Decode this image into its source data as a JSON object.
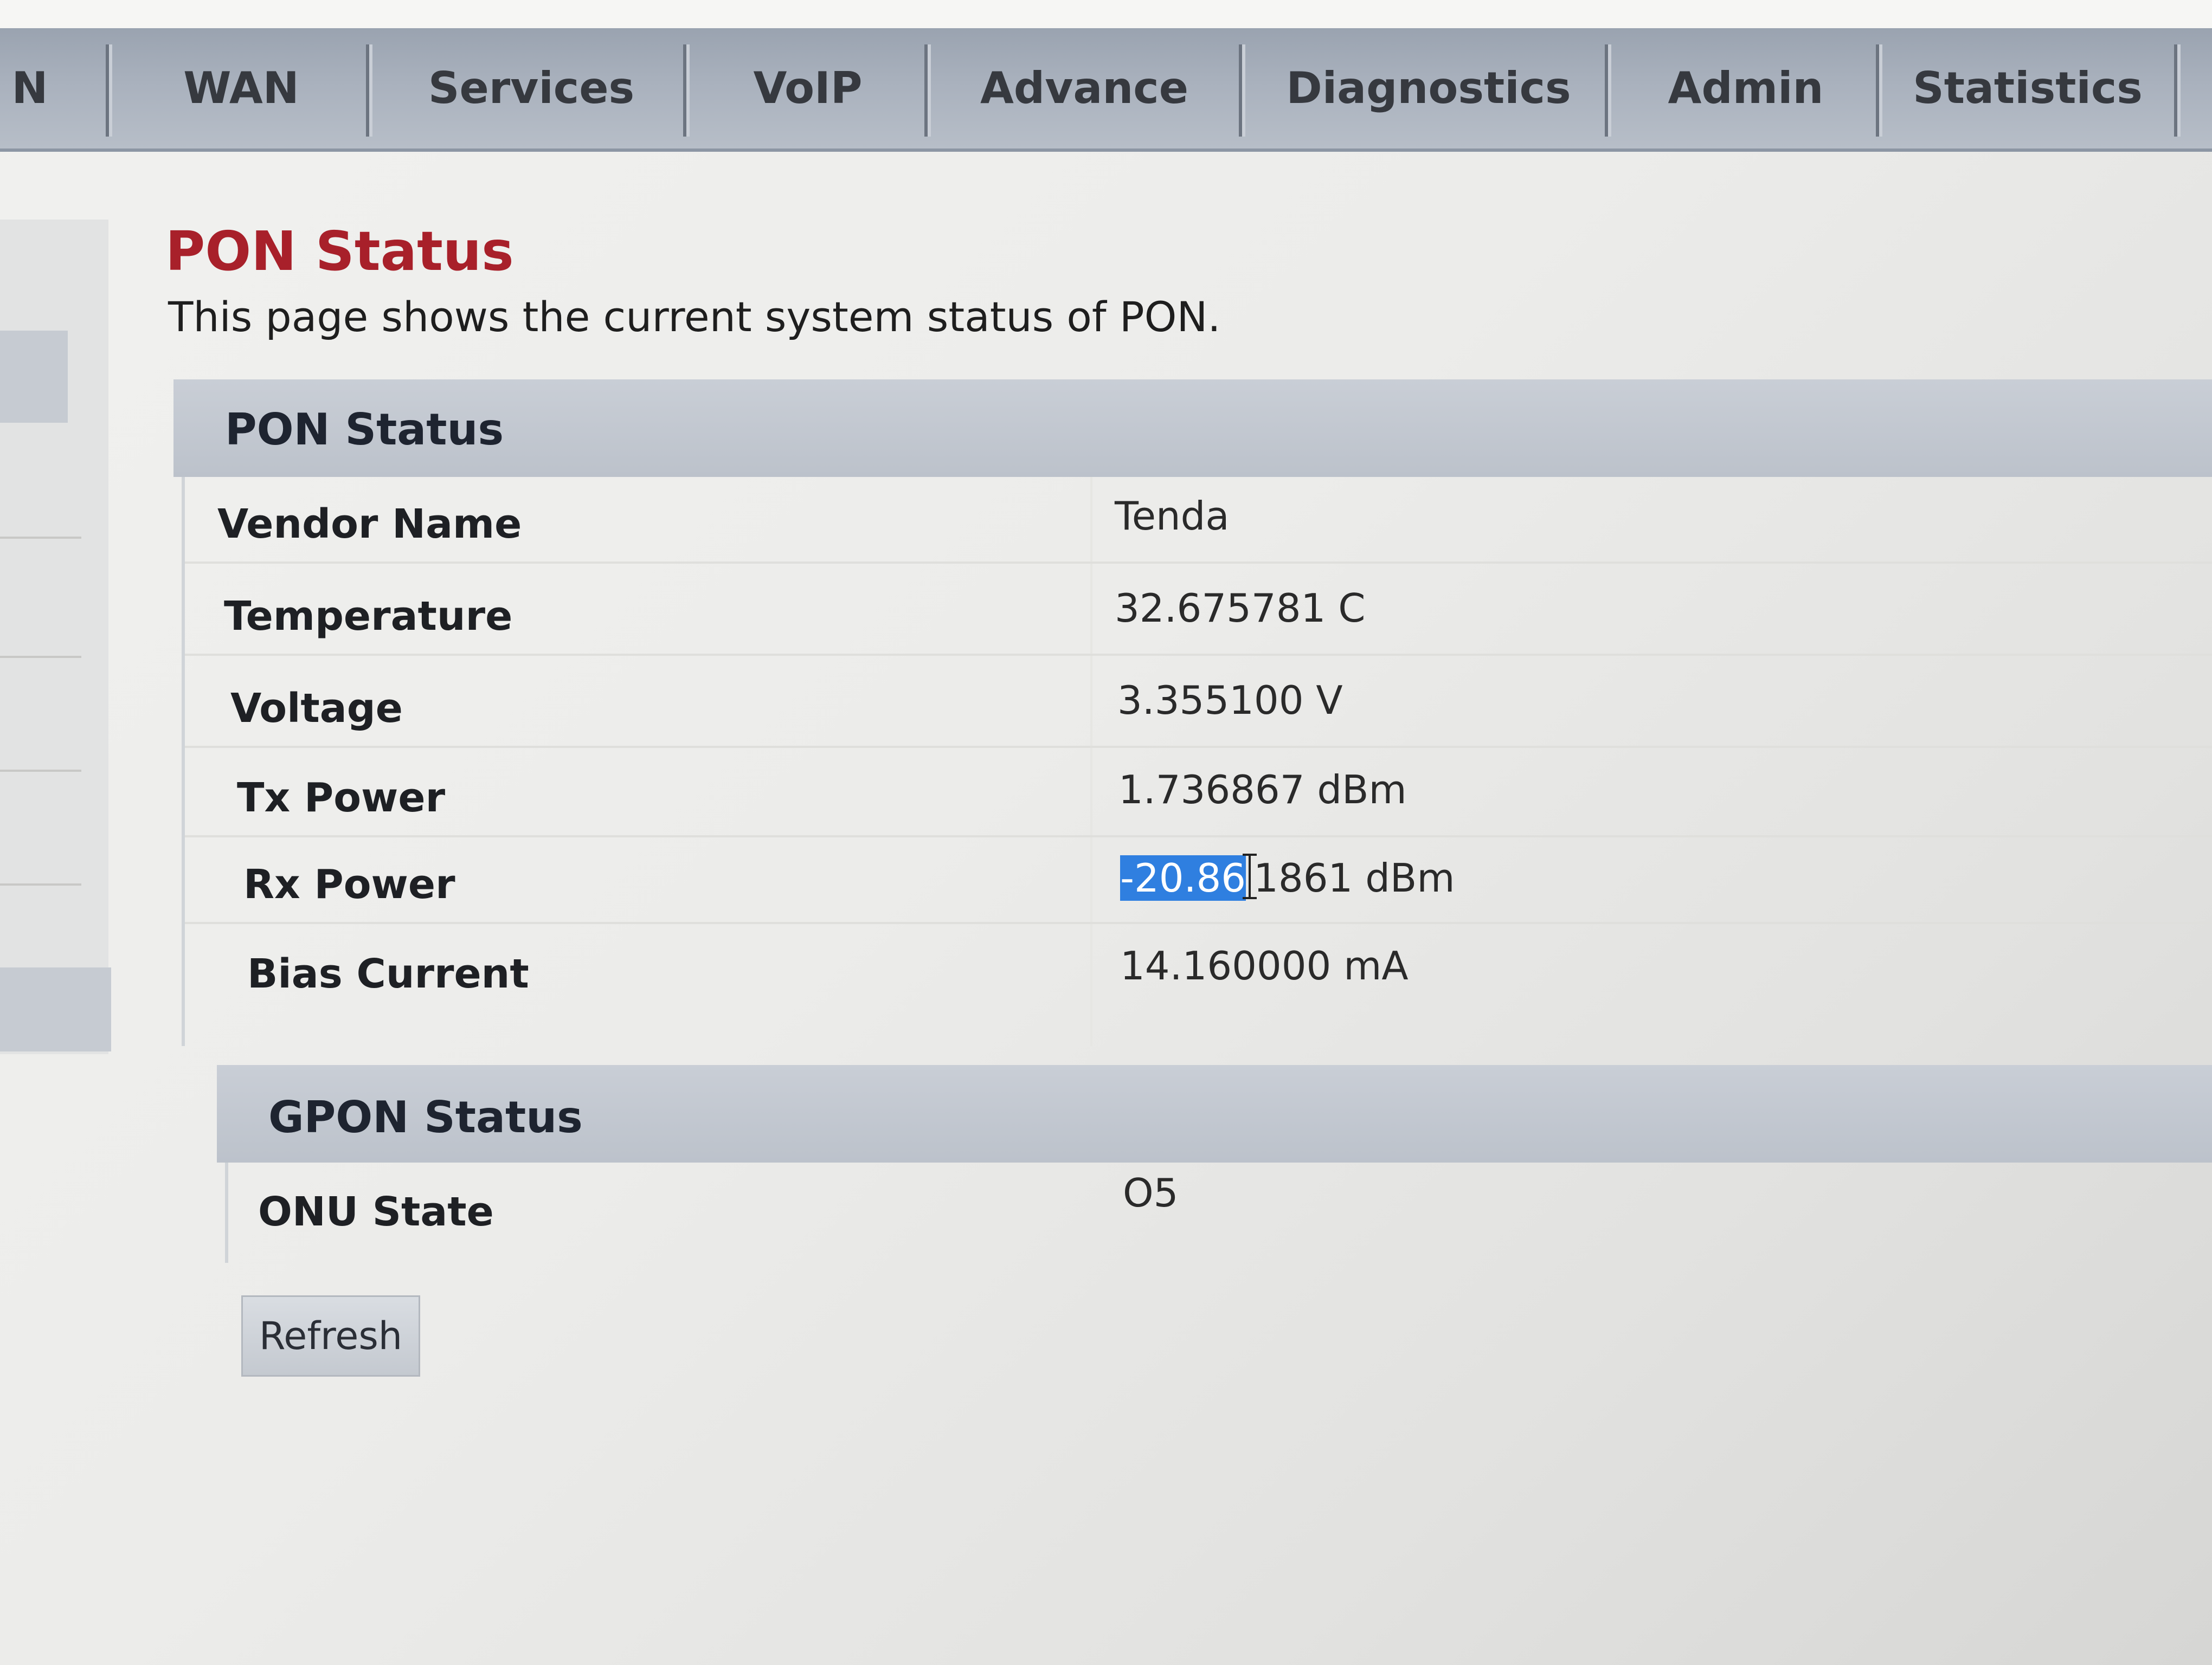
{
  "nav": {
    "items": [
      {
        "label": "N"
      },
      {
        "label": "WAN"
      },
      {
        "label": "Services"
      },
      {
        "label": "VoIP"
      },
      {
        "label": "Advance"
      },
      {
        "label": "Diagnostics"
      },
      {
        "label": "Admin"
      },
      {
        "label": "Statistics"
      }
    ]
  },
  "page": {
    "title": "PON Status",
    "description": "This page shows the current system status of PON."
  },
  "pon_status": {
    "header": "PON Status",
    "rows": [
      {
        "label": "Vendor Name",
        "value": "Tenda"
      },
      {
        "label": "Temperature",
        "value": "32.675781 C"
      },
      {
        "label": "Voltage",
        "value": "3.355100 V"
      },
      {
        "label": "Tx Power",
        "value": "1.736867 dBm"
      },
      {
        "label": "Rx Power",
        "value_selected": "-20.86",
        "value_rest": "1861 dBm"
      },
      {
        "label": "Bias Current",
        "value": "14.160000 mA"
      }
    ]
  },
  "gpon_status": {
    "header": "GPON Status",
    "rows": [
      {
        "label": "ONU State",
        "value": "O5"
      }
    ]
  },
  "buttons": {
    "refresh_label": "Refresh"
  },
  "colors": {
    "title_red": "#a8202a",
    "selection_blue": "#2f7fe0",
    "header_gray": "#c3c8d0"
  }
}
